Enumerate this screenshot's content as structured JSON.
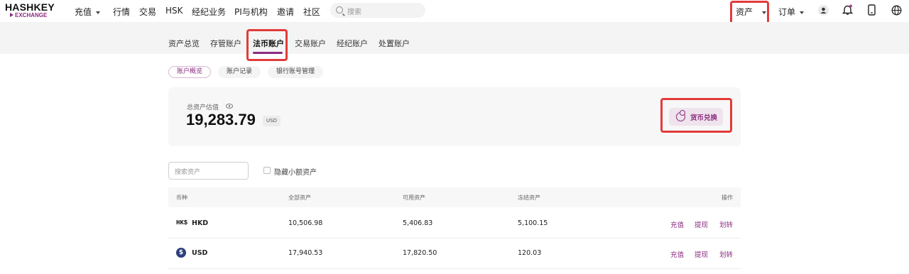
{
  "brand": {
    "name": "HASHKEY",
    "sub": "EXCHANGE",
    "accent": "#8b2c7e"
  },
  "nav": {
    "items": [
      "充值",
      "行情",
      "交易",
      "HSK",
      "经纪业务",
      "PI与机构",
      "邀请",
      "社区"
    ],
    "search_placeholder": "搜索"
  },
  "header_right": {
    "assets_label": "资产",
    "orders_label": "订单",
    "icons": [
      "avatar-icon",
      "bell-icon",
      "phone-icon",
      "globe-icon"
    ]
  },
  "tabs": [
    {
      "label": "资产总览",
      "active": false
    },
    {
      "label": "存管账户",
      "active": false
    },
    {
      "label": "法币账户",
      "active": true
    },
    {
      "label": "交易账户",
      "active": false
    },
    {
      "label": "经纪账户",
      "active": false
    },
    {
      "label": "处置账户",
      "active": false
    }
  ],
  "subtabs": [
    {
      "label": "账户概览",
      "active": true
    },
    {
      "label": "账户记录",
      "active": false
    },
    {
      "label": "银行账号管理",
      "active": false
    }
  ],
  "summary": {
    "label": "总资产估值",
    "value": "19,283.79",
    "unit": "USD",
    "convert_label": "货币兑换"
  },
  "filter": {
    "search_placeholder": "搜索资产",
    "hide_small_label": "隐藏小额资产"
  },
  "table": {
    "headers": {
      "coin": "币种",
      "total": "全部资产",
      "available": "可用资产",
      "frozen": "冻结资产",
      "action": "操作"
    },
    "rows": [
      {
        "icon": "HK$",
        "coin": "HKD",
        "total": "10,506.98",
        "available": "5,406.83",
        "frozen": "5,100.15"
      },
      {
        "icon": "$",
        "coin": "USD",
        "total": "17,940.53",
        "available": "17,820.50",
        "frozen": "120.03"
      }
    ],
    "actions": {
      "deposit": "充值",
      "withdraw": "提现",
      "transfer": "划转"
    }
  }
}
